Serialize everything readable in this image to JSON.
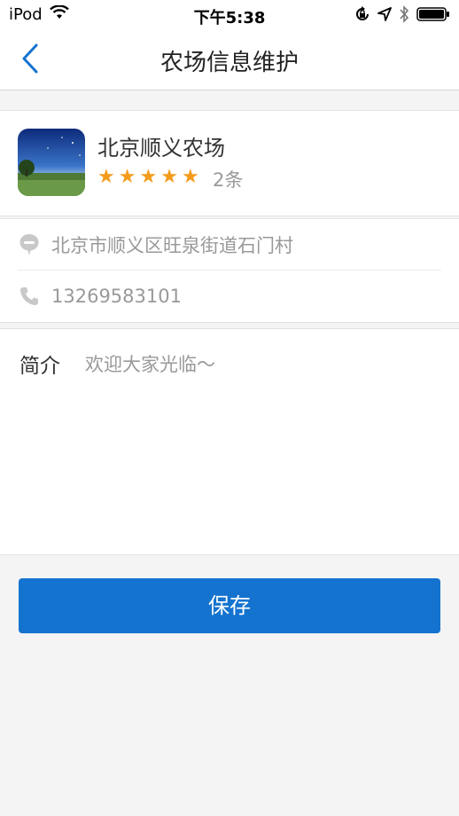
{
  "status_bar": {
    "carrier": "iPod",
    "time": "下午5:38",
    "icons": [
      "wifi-icon",
      "rotation-lock-icon",
      "location-icon",
      "bluetooth-icon",
      "battery-icon"
    ]
  },
  "nav": {
    "back_icon": "chevron-left-icon",
    "title": "农场信息维护"
  },
  "farm": {
    "name": "北京顺义农场",
    "rating": 5,
    "stars": [
      "★",
      "★",
      "★",
      "★",
      "★"
    ],
    "review_count": "2条"
  },
  "contact": {
    "address_icon": "location-pin-icon",
    "address": "北京市顺义区旺泉街道石门村",
    "phone_icon": "phone-icon",
    "phone": "13269583101"
  },
  "intro": {
    "label": "简介",
    "value": "欢迎大家光临～"
  },
  "save_label": "保存",
  "colors": {
    "accent": "#1473cf",
    "star": "#f39b1c",
    "background": "#f4f4f4"
  }
}
